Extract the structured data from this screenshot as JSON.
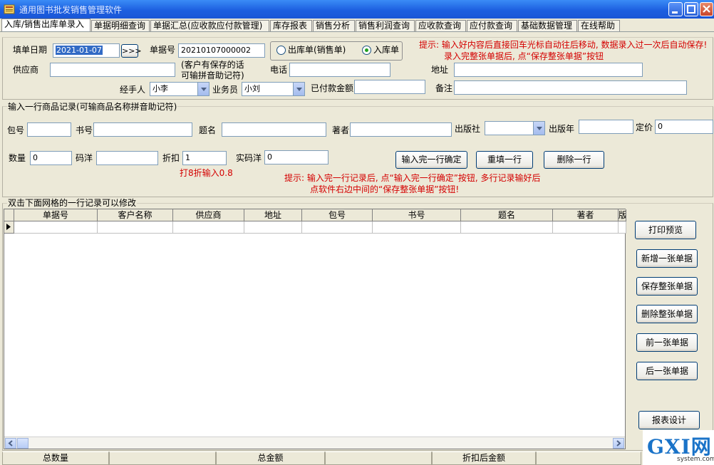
{
  "window": {
    "title": "通用图书批发销售管理软件"
  },
  "tabs": [
    "入库/销售出库单录入",
    "单据明细查询",
    "单据汇总(应收款应付款管理)",
    "库存报表",
    "销售分析",
    "销售利润查询",
    "应收款查询",
    "应付款查询",
    "基础数据管理",
    "在线帮助"
  ],
  "header": {
    "date_label": "填单日期",
    "date_value": "2021-01-07",
    "date_btn": ">>>",
    "billno_label": "单据号",
    "billno_value": "20210107000002",
    "radio_out": "出库单(销售单)",
    "radio_in": "入库单",
    "supplier_label": "供应商",
    "supplier_value": "",
    "supplier_note_1": "(客户有保存的话",
    "supplier_note_2": "可输拼音助记符)",
    "phone_label": "电话",
    "phone_value": "",
    "address_label": "地址",
    "address_value": "",
    "handler_label": "经手人",
    "handler_value": "小李",
    "sales_label": "业务员",
    "sales_value": "小刘",
    "paid_label": "已付款金额",
    "paid_value": "",
    "remark_label": "备注",
    "remark_value": "",
    "tip_1": "提示: 输入好内容后直接回车光标自动往后移动, 数据录入过一次后自动保存!",
    "tip_2": "录入完整张单据后, 点“保存整张单据”按钮"
  },
  "entry": {
    "section_title": "输入一行商品记录(可输商品名称拼音助记符)",
    "pkg_label": "包号",
    "pkg_value": "",
    "isbn_label": "书号",
    "isbn_value": "",
    "title_label": "题名",
    "title_value": "",
    "author_label": "著者",
    "author_value": "",
    "publisher_label": "出版社",
    "publisher_value": "",
    "year_label": "出版年",
    "year_value": "",
    "price_label": "定价",
    "price_value": "0",
    "qty_label": "数量",
    "qty_value": "0",
    "code_label": "码洋",
    "code_value": "",
    "discount_label": "折扣",
    "discount_value": "1",
    "real_label": "实码洋",
    "real_value": "0",
    "discount_hint": "打8折输入0.8",
    "btn_confirm": "输入完一行确定",
    "btn_reset": "重填一行",
    "btn_delete": "删除一行",
    "tip_1": "提示: 输入完一行记录后, 点“输入完一行确定”按钮, 多行记录输好后",
    "tip_2": "点软件右边中间的“保存整张单据”按钮!"
  },
  "grid": {
    "section_title": "双击下面网格的一行记录可以修改",
    "columns": [
      "单据号",
      "客户名称",
      "供应商",
      "地址",
      "包号",
      "书号",
      "题名",
      "著者",
      "版"
    ]
  },
  "side_buttons": [
    "打印预览",
    "新增一张单据",
    "保存整张单据",
    "删除整张单据",
    "前一张单据",
    "后一张单据",
    "报表设计"
  ],
  "status": [
    "总数量",
    "总金额",
    "折扣后金额"
  ],
  "watermark": {
    "text": "GXI网",
    "sub": "system.com"
  }
}
